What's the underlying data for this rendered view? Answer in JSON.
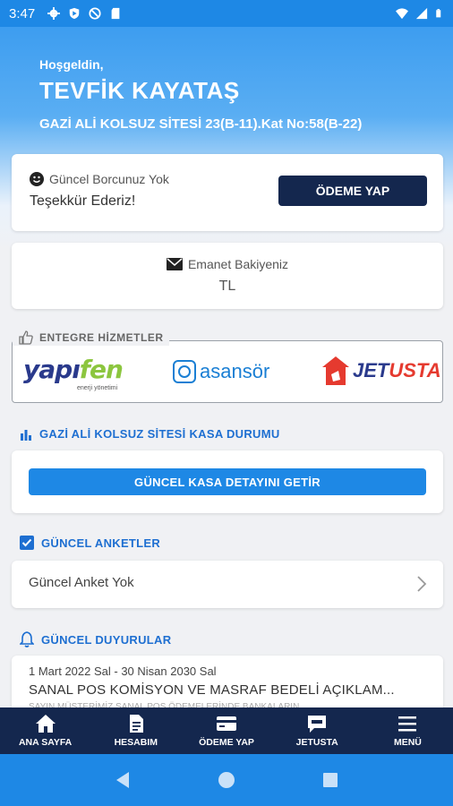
{
  "statusbar": {
    "time": "3:47"
  },
  "header": {
    "greeting": "Hoşgeldin,",
    "username": "TEVFİK KAYATAŞ",
    "address": "GAZİ ALİ KOLSUZ SİTESİ 23(B-11).Kat No:58(B-22)"
  },
  "debt": {
    "status": "Güncel Borcunuz Yok",
    "thanks": "Teşekkür Ederiz!",
    "pay_label": "ÖDEME YAP"
  },
  "deposit": {
    "label": "Emanet Bakiyeniz",
    "value": "TL"
  },
  "integrated": {
    "title": "ENTEGRE HİZMETLER",
    "logos": {
      "yapifen": "yapifen",
      "yapifen_sub": "enerji yönetimi",
      "asansor": "asansör",
      "jet": "JET",
      "usta": "USTA"
    }
  },
  "kasa": {
    "title": "GAZİ ALİ KOLSUZ SİTESİ KASA DURUMU",
    "button_label": "GÜNCEL KASA DETAYINI GETİR"
  },
  "anket": {
    "title": "GÜNCEL ANKETLER",
    "empty_text": "Güncel Anket Yok"
  },
  "duyuru": {
    "title": "GÜNCEL DUYURULAR",
    "date": "1 Mart 2022 Sal - 30 Nisan 2030 Sal",
    "item_title": "SANAL POS KOMİSYON VE MASRAF BEDELİ AÇIKLAM...",
    "item_body": "SAYIN MÜŞTERİMİZ SANAL POS ÖDEMELERİNDE BANKALARIN"
  },
  "bottomnav": {
    "items": [
      {
        "label": "ANA SAYFA",
        "icon": "home-icon"
      },
      {
        "label": "HESABIM",
        "icon": "document-icon"
      },
      {
        "label": "ÖDEME YAP",
        "icon": "card-icon"
      },
      {
        "label": "JETUSTA",
        "icon": "chat-icon"
      },
      {
        "label": "MENÜ",
        "icon": "menu-icon"
      }
    ]
  },
  "colors": {
    "primary": "#1e88e5",
    "dark_navy": "#14274e",
    "section_blue": "#1e6fd1"
  }
}
